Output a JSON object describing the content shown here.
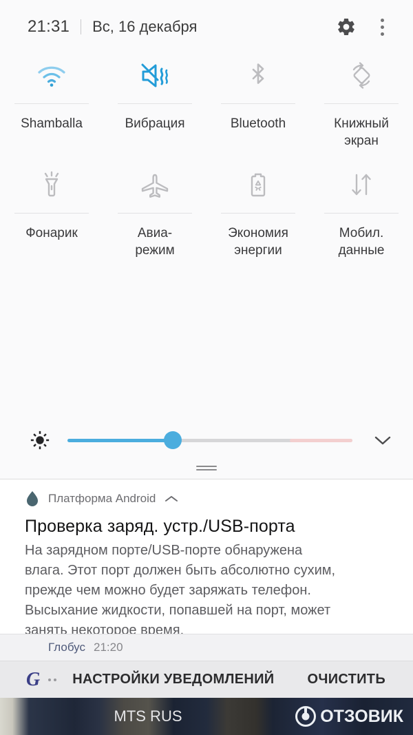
{
  "header": {
    "time": "21:31",
    "date": "Вс, 16 декабря",
    "settings_icon": "gear-icon",
    "overflow_icon": "more-vertical-icon"
  },
  "quick_settings": {
    "tiles": [
      {
        "label": "Shamballa",
        "icon": "wifi-icon",
        "active": true,
        "color": "#4db4e8"
      },
      {
        "label": "Вибрация",
        "icon": "vibrate-mute-icon",
        "active": true,
        "color": "#229cd8"
      },
      {
        "label": "Bluetooth",
        "icon": "bluetooth-icon",
        "active": false,
        "color": "#b9b9bc"
      },
      {
        "label": "Книжный\nэкран",
        "icon": "auto-rotate-icon",
        "active": false,
        "color": "#b9b9bc"
      },
      {
        "label": "Фонарик",
        "icon": "flashlight-icon",
        "active": false,
        "color": "#b9b9bc"
      },
      {
        "label": "Авиа-\nрежим",
        "icon": "airplane-icon",
        "active": false,
        "color": "#b9b9bc"
      },
      {
        "label": "Экономия\nэнергии",
        "icon": "power-saving-icon",
        "active": false,
        "color": "#b9b9bc"
      },
      {
        "label": "Мобил.\nданные",
        "icon": "mobile-data-icon",
        "active": false,
        "color": "#b9b9bc"
      }
    ]
  },
  "brightness": {
    "icon": "brightness-icon",
    "value_percent": 37,
    "fill_color": "#4badde",
    "track_color": "#d6d6d8",
    "warm_color": "#f3cfcf",
    "expand_icon": "chevron-down-icon"
  },
  "notifications": {
    "primary": {
      "icon": "water-drop-icon",
      "app": "Платформа Android",
      "collapse_icon": "chevron-up-icon",
      "title": "Проверка заряд. устр./USB-порта",
      "body": "На зарядном порте/USB-порте обнаружена\nвлага. Этот порт должен быть абсолютно сухим,\nпрежде чем можно будет заряжать телефон.\nВысыхание жидкости, попавшей на порт, может\nзанять некоторое время."
    },
    "secondary": {
      "app": "Глобус",
      "time": "21:20"
    }
  },
  "action_bar": {
    "logo": "G",
    "settings_label": "НАСТРОЙКИ УВЕДОМЛЕНИЙ",
    "clear_label": "ОЧИСТИТЬ"
  },
  "wallpaper": {
    "carrier": "MTS RUS",
    "watermark": "ОТЗОВИК"
  }
}
